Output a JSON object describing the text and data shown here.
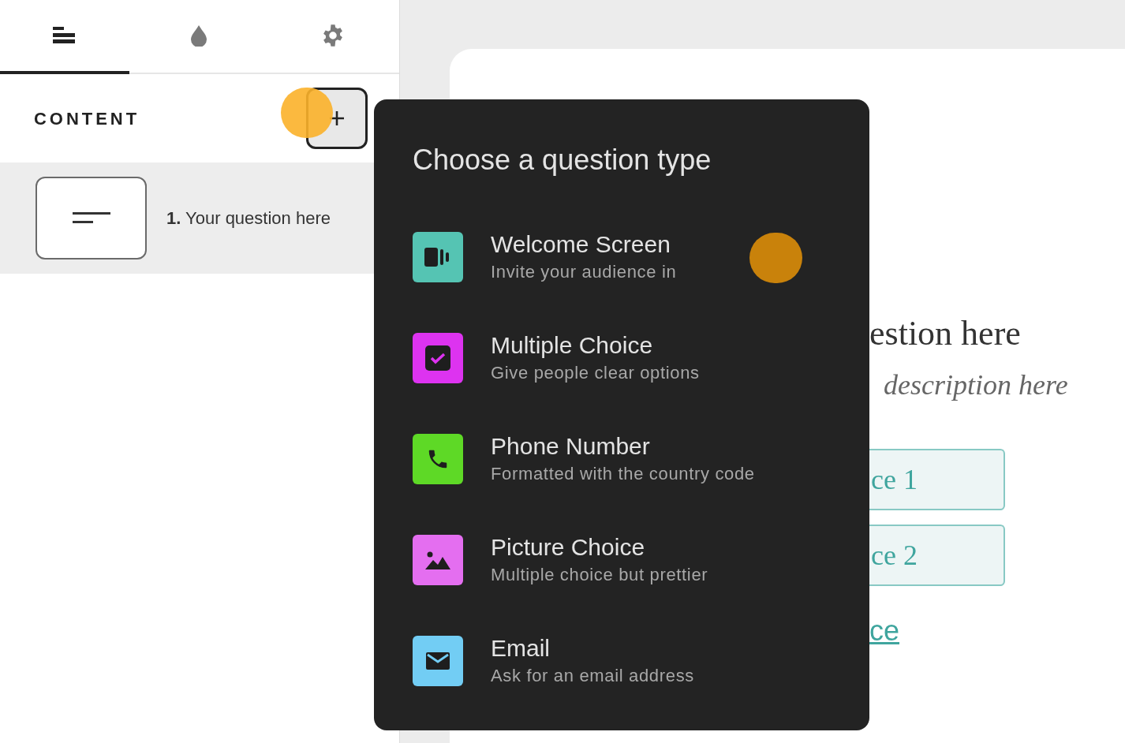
{
  "tabs": [
    {
      "kind": "content",
      "selected": true
    },
    {
      "kind": "design",
      "selected": false
    },
    {
      "kind": "settings",
      "selected": false
    }
  ],
  "content_header": {
    "label": "CONTENT"
  },
  "questions": [
    {
      "number": "1.",
      "text": "Your question here",
      "selected": true
    }
  ],
  "question_type_menu": {
    "title": "Choose a question type",
    "items": [
      {
        "kind": "welcome",
        "color": "#55c4b3",
        "title": "Welcome Screen",
        "subtitle": "Invite your audience in"
      },
      {
        "kind": "choice",
        "color": "#dd33f0",
        "title": "Multiple Choice",
        "subtitle": "Give people clear options"
      },
      {
        "kind": "phone",
        "color": "#5ed926",
        "title": "Phone Number",
        "subtitle": "Formatted with the country code"
      },
      {
        "kind": "picture",
        "color": "#e46ef0",
        "title": "Picture Choice",
        "subtitle": "Multiple choice but prettier"
      },
      {
        "kind": "email",
        "color": "#72cdf4",
        "title": "Email",
        "subtitle": "Ask for an email address"
      }
    ]
  },
  "preview": {
    "question": "estion here",
    "description": "description here",
    "choices": [
      "ce 1",
      "ce 2"
    ],
    "add_choice": "ce"
  }
}
